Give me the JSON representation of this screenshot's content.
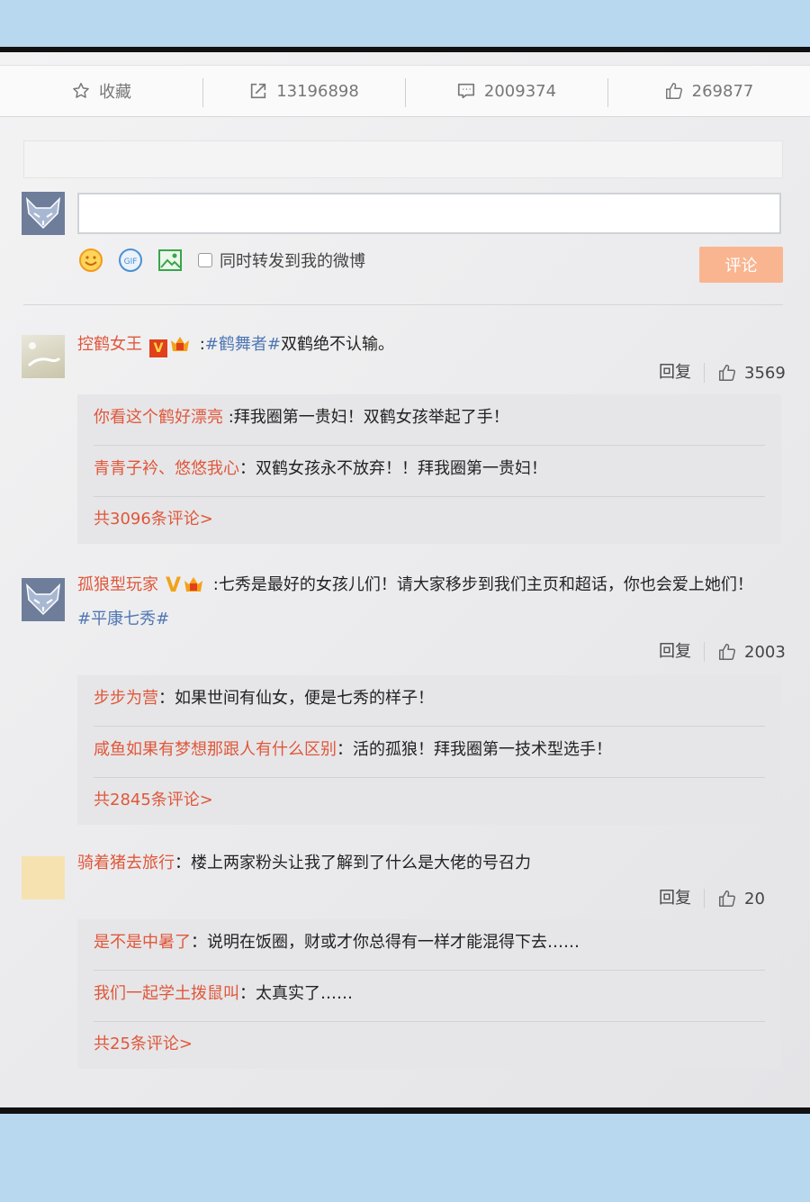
{
  "actions": {
    "favorite_label": "收藏",
    "repost_count": "13196898",
    "comment_count": "2009374",
    "like_count": "269877"
  },
  "composer": {
    "sync_label": "同时转发到我的微博",
    "post_label": "评论"
  },
  "reply_label": "回复",
  "comments": [
    {
      "user": "控鹤女王",
      "sep": " :",
      "topic": "#鹤舞者#",
      "text": "双鹤绝不认输。",
      "likes": "3569",
      "replies": [
        {
          "user": "你看这个鹤好漂亮",
          "text": " :拜我圈第一贵妇！双鹤女孩举起了手！"
        },
        {
          "user": "青青子衿、悠悠我心",
          "text": "：双鹤女孩永不放弃！！拜我圈第一贵妇！"
        }
      ],
      "more": "共3096条评论>"
    },
    {
      "user": "孤狼型玩家",
      "sep": " :",
      "text": "七秀是最好的女孩儿们！请大家移步到我们主页和超话，你也会爱上她们！",
      "topic": "#平康七秀#",
      "likes": "2003",
      "replies": [
        {
          "user": "步步为营",
          "text": "：如果世间有仙女，便是七秀的样子！"
        },
        {
          "user": "咸鱼如果有梦想那跟人有什么区别",
          "text": "：活的孤狼！拜我圈第一技术型选手！"
        }
      ],
      "more": "共2845条评论>"
    },
    {
      "user": "骑着猪去旅行",
      "sep": "：",
      "text": "楼上两家粉头让我了解到了什么是大佬的号召力",
      "likes": "20",
      "replies": [
        {
          "user": "是不是中暑了",
          "text": "：说明在饭圈，财或才你总得有一样才能混得下去……"
        },
        {
          "user": "我们一起学土拨鼠叫",
          "text": "：太真实了……"
        }
      ],
      "more": "共25条评论>"
    }
  ]
}
